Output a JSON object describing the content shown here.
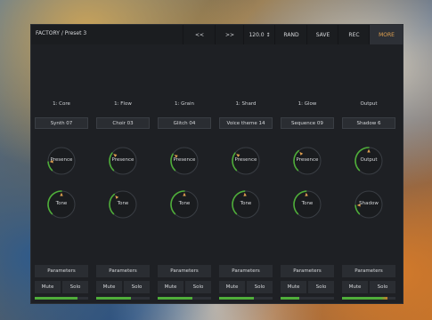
{
  "header": {
    "title": "FACTORY / Preset 3",
    "buttons": [
      {
        "label": "<<"
      },
      {
        "label": ">>"
      },
      {
        "label": "120.0 ↕"
      },
      {
        "label": "RAND"
      },
      {
        "label": "SAVE"
      },
      {
        "label": "REC"
      },
      {
        "label": "MORE"
      }
    ]
  },
  "channels": [
    {
      "name": "1: Core",
      "preset": "Synth 07",
      "knob1": {
        "label": "Presence",
        "value": 0.15
      },
      "knob2": {
        "label": "Tone",
        "value": 0.5
      },
      "params": "Parameters",
      "mute": "Mute",
      "solo": "Solo",
      "level": 0.8
    },
    {
      "name": "1: Flow",
      "preset": "Choir 03",
      "knob1": {
        "label": "Presence",
        "value": 0.3
      },
      "knob2": {
        "label": "Tone",
        "value": 0.35
      },
      "params": "Parameters",
      "mute": "Mute",
      "solo": "Solo",
      "level": 0.65
    },
    {
      "name": "1: Grain",
      "preset": "Glitch 04",
      "knob1": {
        "label": "Presence",
        "value": 0.28
      },
      "knob2": {
        "label": "Tone",
        "value": 0.5
      },
      "params": "Parameters",
      "mute": "Mute",
      "solo": "Solo",
      "level": 0.65
    },
    {
      "name": "1: Shard",
      "preset": "Voice theme 14",
      "knob1": {
        "label": "Presence",
        "value": 0.3
      },
      "knob2": {
        "label": "Tone",
        "value": 0.48
      },
      "params": "Parameters",
      "mute": "Mute",
      "solo": "Solo",
      "level": 0.65
    },
    {
      "name": "1: Glow",
      "preset": "Sequence 09",
      "knob1": {
        "label": "Presence",
        "value": 0.35
      },
      "knob2": {
        "label": "Tone",
        "value": 0.48
      },
      "params": "Parameters",
      "mute": "Mute",
      "solo": "Solo",
      "level": 0.35
    },
    {
      "name": "Output",
      "preset": "Shadow 6",
      "knob1": {
        "label": "Output",
        "value": 0.5
      },
      "knob2": {
        "label": "Shadow",
        "value": 0.15,
        "full": true
      },
      "params": "Parameters",
      "mute": "Mute",
      "solo": "Solo",
      "level": 0.85,
      "warm": true
    }
  ],
  "colors": {
    "accent": "#e0a050",
    "knob_arc": "#4fae3a",
    "meter": "#4fae3a"
  }
}
